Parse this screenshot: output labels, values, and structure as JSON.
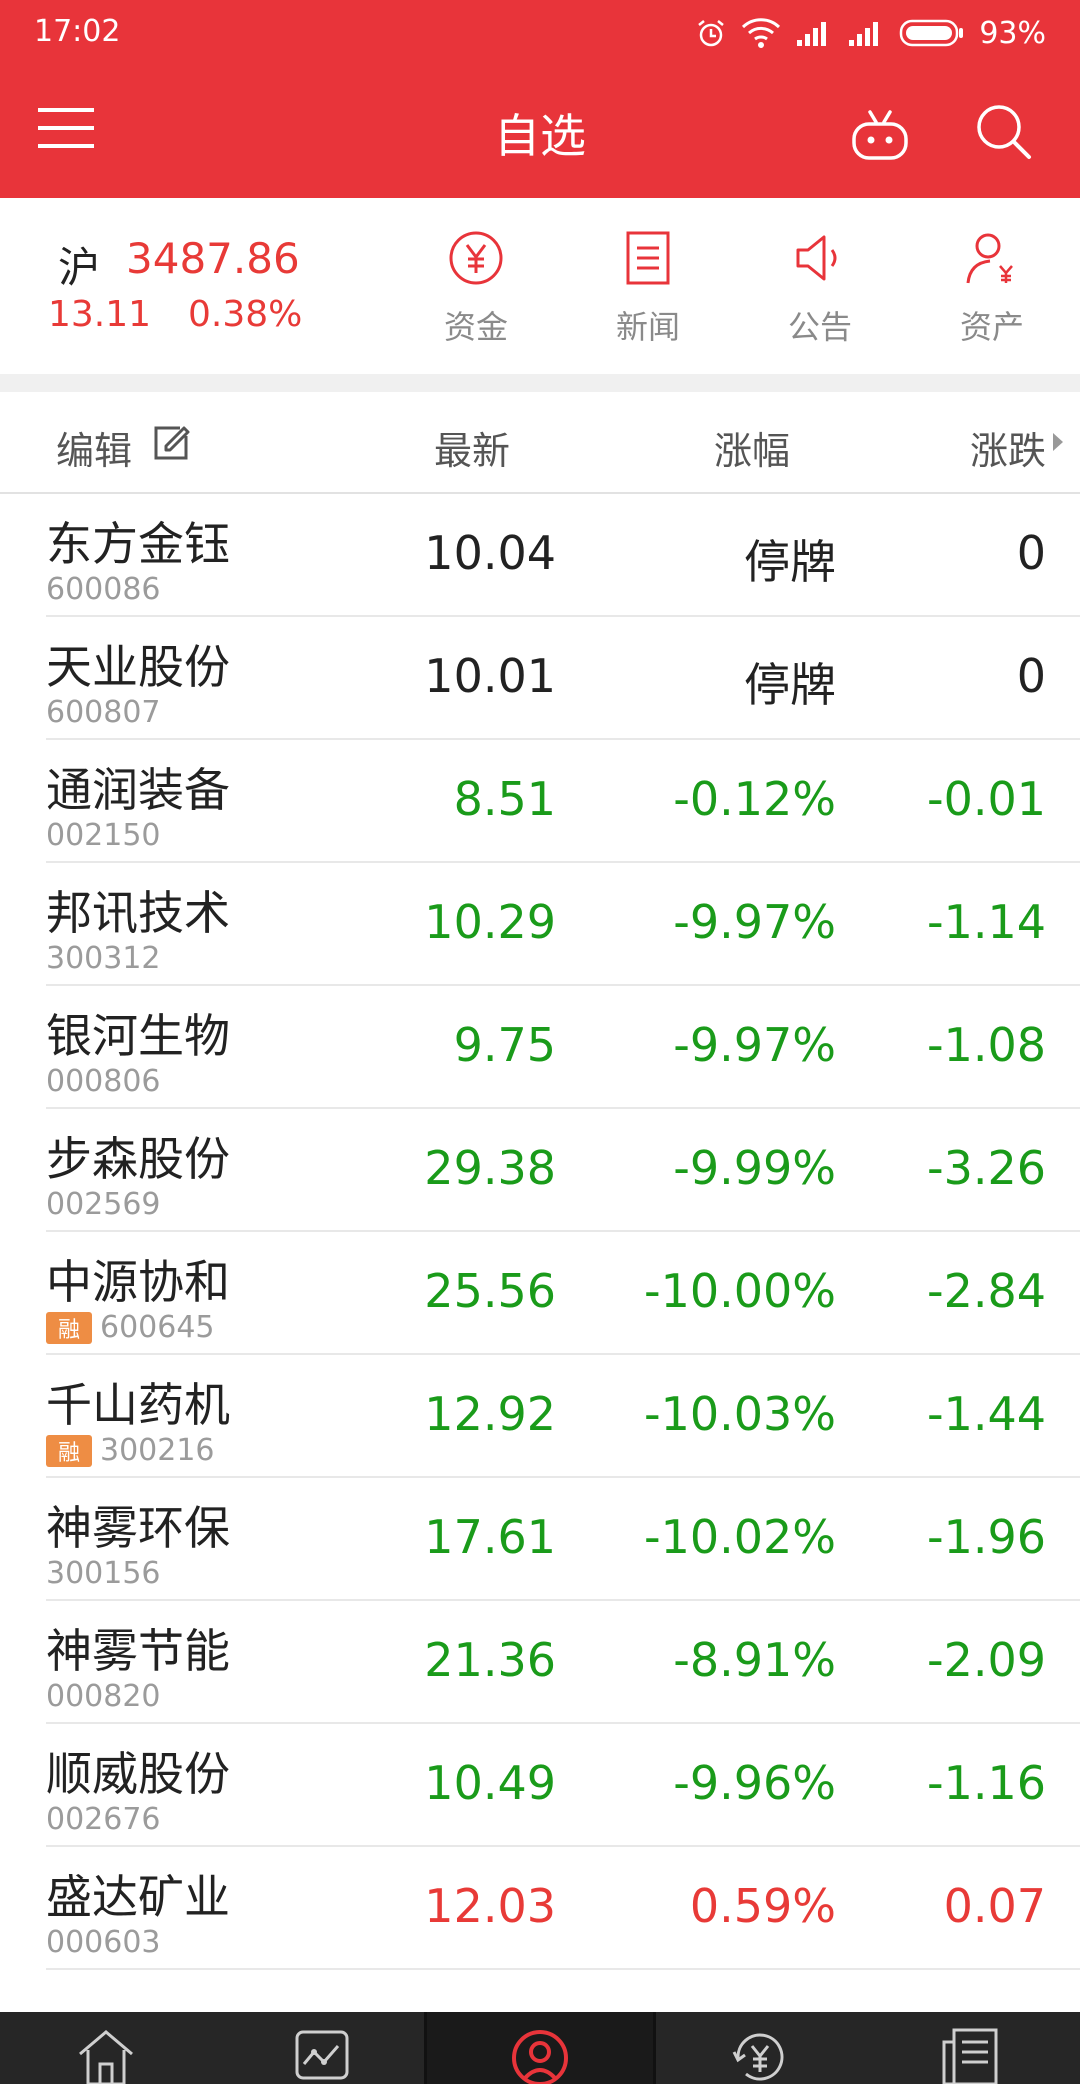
{
  "status": {
    "time": "17:02",
    "battery": "93%"
  },
  "header": {
    "title": "自选"
  },
  "index": {
    "name": "沪",
    "value": "3487.86",
    "change": "13.11",
    "percent": "0.38%"
  },
  "quick_entries": [
    {
      "label": "资金",
      "icon": "yuan-circle-icon"
    },
    {
      "label": "新闻",
      "icon": "news-document-icon"
    },
    {
      "label": "公告",
      "icon": "speaker-icon"
    },
    {
      "label": "资产",
      "icon": "user-yuan-icon"
    }
  ],
  "table_header": {
    "edit": "编辑",
    "latest": "最新",
    "pct": "涨幅",
    "chg": "涨跌"
  },
  "stocks": [
    {
      "name": "东方金钰",
      "code": "600086",
      "badge": "",
      "latest": "10.04",
      "pct": "停牌",
      "chg": "0",
      "tone": "dark"
    },
    {
      "name": "天业股份",
      "code": "600807",
      "badge": "",
      "latest": "10.01",
      "pct": "停牌",
      "chg": "0",
      "tone": "dark"
    },
    {
      "name": "通润装备",
      "code": "002150",
      "badge": "",
      "latest": "8.51",
      "pct": "-0.12%",
      "chg": "-0.01",
      "tone": "green"
    },
    {
      "name": "邦讯技术",
      "code": "300312",
      "badge": "",
      "latest": "10.29",
      "pct": "-9.97%",
      "chg": "-1.14",
      "tone": "green"
    },
    {
      "name": "银河生物",
      "code": "000806",
      "badge": "",
      "latest": "9.75",
      "pct": "-9.97%",
      "chg": "-1.08",
      "tone": "green"
    },
    {
      "name": "步森股份",
      "code": "002569",
      "badge": "",
      "latest": "29.38",
      "pct": "-9.99%",
      "chg": "-3.26",
      "tone": "green"
    },
    {
      "name": "中源协和",
      "code": "600645",
      "badge": "融",
      "latest": "25.56",
      "pct": "-10.00%",
      "chg": "-2.84",
      "tone": "green"
    },
    {
      "name": "千山药机",
      "code": "300216",
      "badge": "融",
      "latest": "12.92",
      "pct": "-10.03%",
      "chg": "-1.44",
      "tone": "green"
    },
    {
      "name": "神雾环保",
      "code": "300156",
      "badge": "",
      "latest": "17.61",
      "pct": "-10.02%",
      "chg": "-1.96",
      "tone": "green"
    },
    {
      "name": "神雾节能",
      "code": "000820",
      "badge": "",
      "latest": "21.36",
      "pct": "-8.91%",
      "chg": "-2.09",
      "tone": "green"
    },
    {
      "name": "顺威股份",
      "code": "002676",
      "badge": "",
      "latest": "10.49",
      "pct": "-9.96%",
      "chg": "-1.16",
      "tone": "green"
    },
    {
      "name": "盛达矿业",
      "code": "000603",
      "badge": "",
      "latest": "12.03",
      "pct": "0.59%",
      "chg": "0.07",
      "tone": "red"
    }
  ],
  "bottom_nav": [
    {
      "icon": "home-icon"
    },
    {
      "icon": "market-chart-icon"
    },
    {
      "icon": "watchlist-user-icon",
      "active": true
    },
    {
      "icon": "trade-yuan-icon"
    },
    {
      "icon": "info-news-icon"
    }
  ],
  "colors": {
    "brand_red": "#e8343a",
    "up_red": "#e83a37",
    "down_green": "#1a9b1a",
    "badge_orange": "#ee8d44"
  }
}
